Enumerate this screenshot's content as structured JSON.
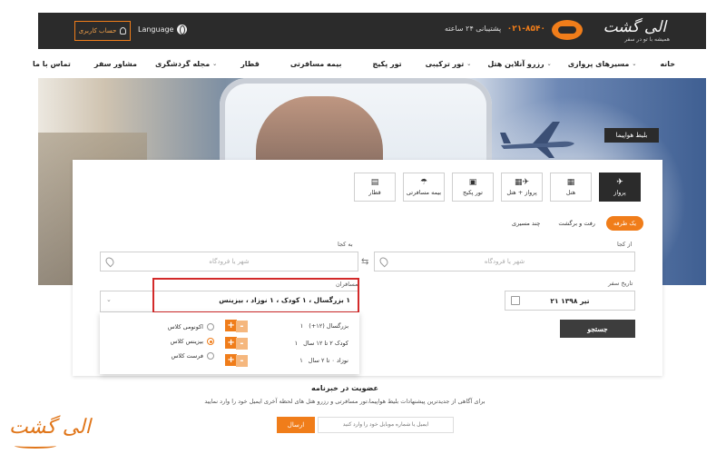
{
  "brand": {
    "name": "الی گشت",
    "tagline": "همیشه با تو در سفر",
    "accent": "#f07d1a",
    "dark": "#2b2b2b"
  },
  "topbar": {
    "phone": "۰۲۱-۸۵۴۰",
    "support_text": "پشتیبانی ۲۴ ساعته",
    "language": "Language",
    "account": "حساب کاربری"
  },
  "nav": {
    "items": [
      {
        "label": "خانه",
        "dropdown": false
      },
      {
        "label": "مسیرهای پروازی",
        "dropdown": true
      },
      {
        "label": "رزرو آنلاین هتل",
        "dropdown": true
      },
      {
        "label": "تور ترکیبی",
        "dropdown": true
      },
      {
        "label": "تور پکیج",
        "dropdown": false
      },
      {
        "label": "بیمه مسافرتی",
        "dropdown": false
      },
      {
        "label": "قطار",
        "dropdown": false
      },
      {
        "label": "مجله گردشگری",
        "dropdown": true
      },
      {
        "label": "مشاور سفر",
        "dropdown": false
      },
      {
        "label": "تماس با ما",
        "dropdown": false
      }
    ]
  },
  "hero": {
    "tag": "بلیط هواپیما"
  },
  "search": {
    "modes": [
      {
        "label": "پرواز",
        "icon": "plane-icon",
        "active": true
      },
      {
        "label": "هتل",
        "icon": "hotel-icon",
        "active": false
      },
      {
        "label": "پرواز + هتل",
        "icon": "flight-hotel-icon",
        "active": false
      },
      {
        "label": "تور پکیج",
        "icon": "bus-icon",
        "active": false
      },
      {
        "label": "بیمه مسافرتی",
        "icon": "umbrella-icon",
        "active": false
      },
      {
        "label": "قطار",
        "icon": "train-icon",
        "active": false
      }
    ],
    "trip_types": [
      {
        "label": "یک طرفه",
        "active": true
      },
      {
        "label": "رفت و برگشت",
        "active": false
      },
      {
        "label": "چند مسیری",
        "active": false
      }
    ],
    "from_label": "از کجا",
    "from_placeholder": "شهر یا فرودگاه",
    "to_label": "به کجا",
    "to_placeholder": "شهر یا فرودگاه",
    "date_label": "تاریخ سفر",
    "date_value": "۲۱ تیر ۱۳۹۸",
    "passengers_label": "مسافران",
    "passengers_value": "۱ بزرگسال ، ۱ کودک ، ۱ نوزاد ، بیزینس",
    "submit": "جستجو"
  },
  "passengers": {
    "rows": [
      {
        "count": "۱",
        "label": "بزرگسال (۱۲+)",
        "plus": "+",
        "minus": "-"
      },
      {
        "count": "۱",
        "label": "کودک ۲ تا ۱۲ سال",
        "plus": "+",
        "minus": "-"
      },
      {
        "count": "۱",
        "label": "نوزاد ۰ تا ۲ سال",
        "plus": "+",
        "minus": "-"
      }
    ],
    "classes": [
      {
        "label": "اکونومی کلاس",
        "selected": false
      },
      {
        "label": "بیزینس کلاس",
        "selected": true
      },
      {
        "label": "فرست کلاس",
        "selected": false
      }
    ]
  },
  "newsletter": {
    "title": "عضویت در خبرنامه",
    "text": "برای آگاهی از جدیدترین پیشنهادات بلیط هواپیما،تور مسافرتی و رزرو هتل های لحظه آخری ایمیل خود را وارد نمایید",
    "placeholder": "ایمیل یا شماره موبایل خود را وارد کنید",
    "button": "ارسال"
  }
}
